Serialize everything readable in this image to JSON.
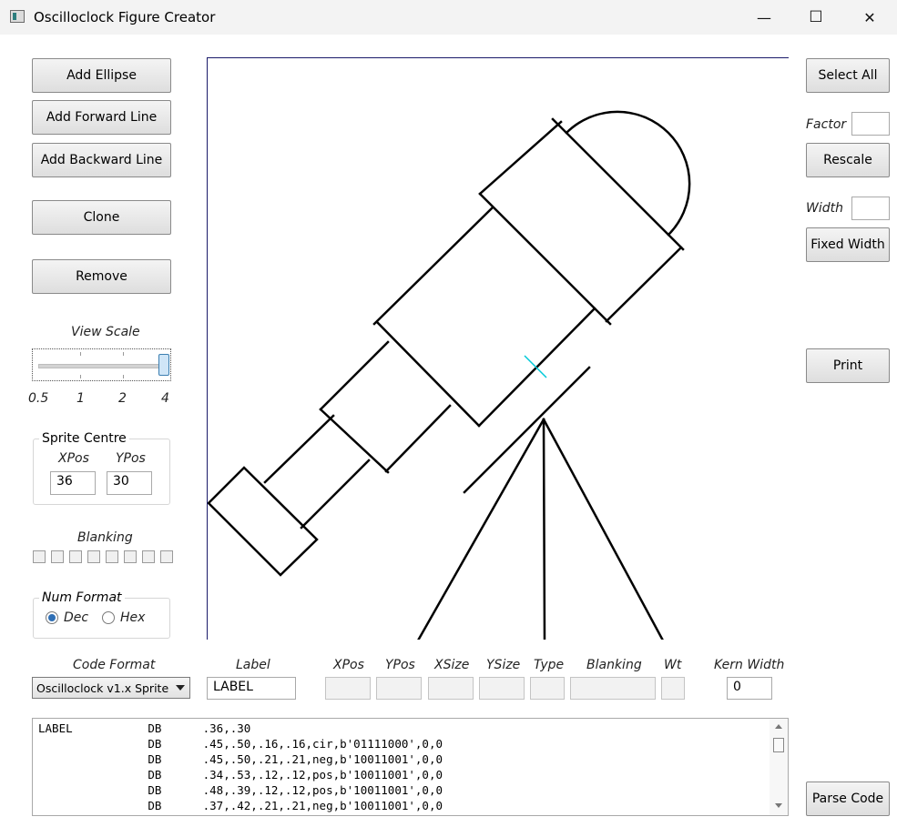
{
  "window": {
    "title": "Oscilloclock Figure Creator",
    "minimize_glyph": "—",
    "maximize_glyph": "☐",
    "close_glyph": "✕"
  },
  "left_panel": {
    "add_ellipse": "Add Ellipse",
    "add_forward_line": "Add Forward Line",
    "add_backward_line": "Add Backward Line",
    "clone": "Clone",
    "remove": "Remove",
    "view_scale": {
      "label": "View Scale",
      "ticks": [
        "0.5",
        "1",
        "2",
        "4"
      ],
      "value": "4"
    },
    "sprite_centre": {
      "title": "Sprite Centre",
      "xpos_label": "XPos",
      "ypos_label": "YPos",
      "xpos": "36",
      "ypos": "30"
    },
    "blanking": {
      "label": "Blanking",
      "bits": [
        false,
        false,
        false,
        false,
        false,
        false,
        false,
        false
      ]
    },
    "num_format": {
      "title": "Num Format",
      "dec": "Dec",
      "hex": "Hex",
      "selected": "Dec"
    }
  },
  "right_panel": {
    "select_all": "Select All",
    "factor_label": "Factor",
    "factor_value": "",
    "rescale": "Rescale",
    "width_label": "Width",
    "width_value": "",
    "fixed_width": "Fixed Width",
    "print": "Print",
    "parse_code": "Parse Code"
  },
  "editor_row": {
    "code_format_label": "Code Format",
    "code_format_value": "Oscilloclock v1.x Sprite",
    "label_label": "Label",
    "label_value": "LABEL",
    "xpos_label": "XPos",
    "ypos_label": "YPos",
    "xsize_label": "XSize",
    "ysize_label": "YSize",
    "type_label": "Type",
    "blanking_label": "Blanking",
    "wt_label": "Wt",
    "kern_width_label": "Kern Width",
    "kern_width_value": "0"
  },
  "code_lines": [
    "LABEL           DB      .36,.30",
    "                DB      .45,.50,.16,.16,cir,b'01111000',0,0",
    "                DB      .45,.50,.21,.21,neg,b'10011001',0,0",
    "                DB      .34,.53,.12,.12,pos,b'10011001',0,0",
    "                DB      .48,.39,.12,.12,pos,b'10011001',0,0",
    "                DB      .37,.42,.21,.21,neg,b'10011001',0,0"
  ],
  "colors": {
    "canvas_border": "#1a1a6a",
    "centre_marker": "#00c8d8",
    "radio_selected": "#2f6fb5"
  }
}
